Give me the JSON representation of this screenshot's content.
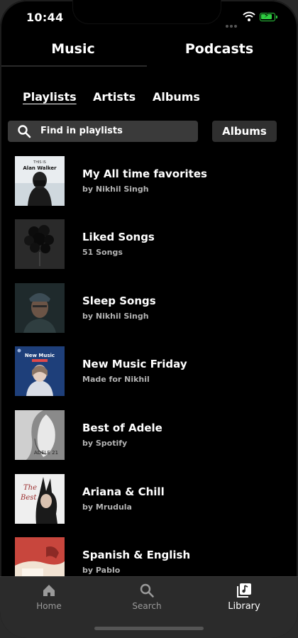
{
  "status_bar": {
    "time": "10:44"
  },
  "top_tabs": {
    "music": "Music",
    "podcasts": "Podcasts"
  },
  "sub_tabs": [
    {
      "label": "Playlists",
      "active": true
    },
    {
      "label": "Artists",
      "active": false
    },
    {
      "label": "Albums",
      "active": false
    }
  ],
  "search": {
    "placeholder": "Find in playlists",
    "icon": "search-icon"
  },
  "sort_button": {
    "label": "Albums"
  },
  "playlists": [
    {
      "title": "My All time favorites",
      "subtitle": "by Nikhil Singh",
      "thumb_text": "THIS IS Alan Walker"
    },
    {
      "title": "Liked Songs",
      "subtitle": "51 Songs"
    },
    {
      "title": "Sleep Songs",
      "subtitle": "by Nikhil Singh"
    },
    {
      "title": "New Music Friday",
      "subtitle": "Made for Nikhil",
      "thumb_text": "New Music"
    },
    {
      "title": "Best of Adele",
      "subtitle": "by Spotify",
      "thumb_text": "ADELE 21"
    },
    {
      "title": "Ariana & Chill",
      "subtitle": "by Mrudula"
    },
    {
      "title": "Spanish & English",
      "subtitle": "by Pablo"
    }
  ],
  "bottom_nav": [
    {
      "label": "Home",
      "icon": "home-icon",
      "active": false
    },
    {
      "label": "Search",
      "icon": "search-icon",
      "active": false
    },
    {
      "label": "Library",
      "icon": "library-icon",
      "active": true
    }
  ],
  "colors": {
    "background": "#000000",
    "nav_bg": "#2b2b2b",
    "muted": "#b3b3b3",
    "battery": "#2ecc40"
  }
}
